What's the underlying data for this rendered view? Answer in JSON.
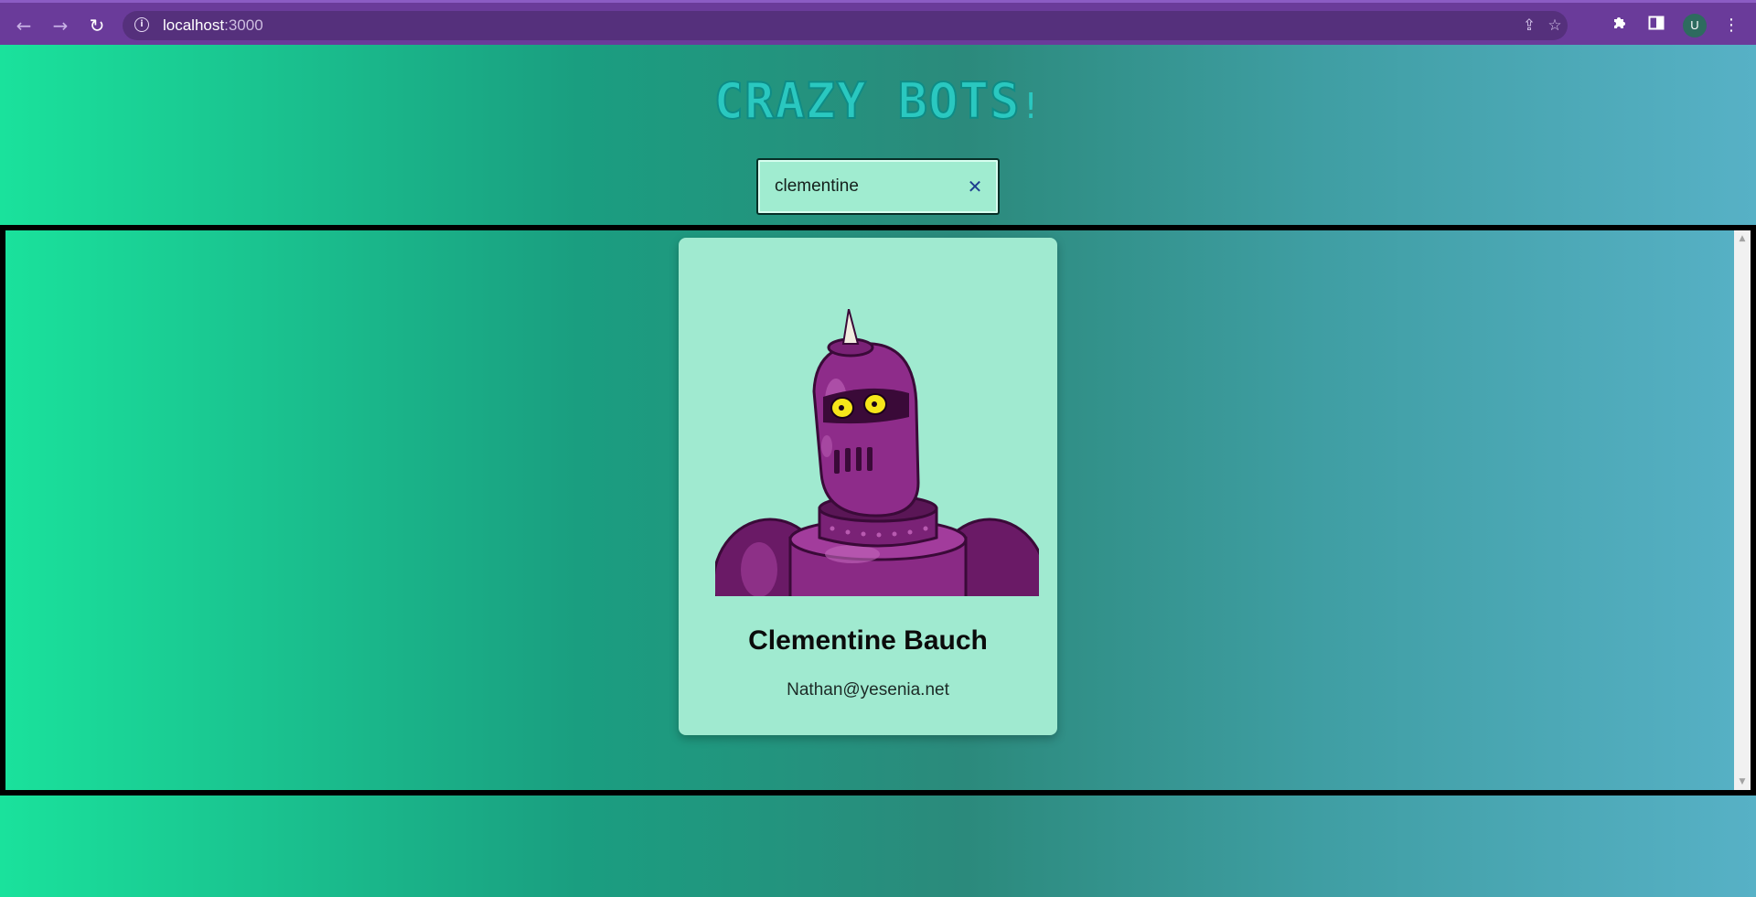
{
  "browser": {
    "url_host": "localhost",
    "url_port": ":3000",
    "avatar_letter": "U",
    "info_glyph": "i"
  },
  "app": {
    "logo_text": "CRAZY BOTS",
    "logo_suffix": "!"
  },
  "search": {
    "value": "clementine",
    "clear_glyph": "✕"
  },
  "results": [
    {
      "name": "Clementine Bauch",
      "email": "Nathan@yesenia.net",
      "image": "purple-robot-avatar"
    }
  ],
  "icons": {
    "back": "back-arrow-icon",
    "forward": "forward-arrow-icon",
    "reload": "reload-icon",
    "share": "share-icon",
    "bookmark": "star-icon",
    "extensions": "puzzle-icon",
    "sidebar": "side-panel-icon",
    "menu": "kebab-menu-icon"
  },
  "colors": {
    "browser_bar": "#6a3b9a",
    "gradient_start": "#1ae29c",
    "gradient_end": "#57b1c6",
    "card_bg": "#a0ead0",
    "logo": "#2ac8c0"
  }
}
